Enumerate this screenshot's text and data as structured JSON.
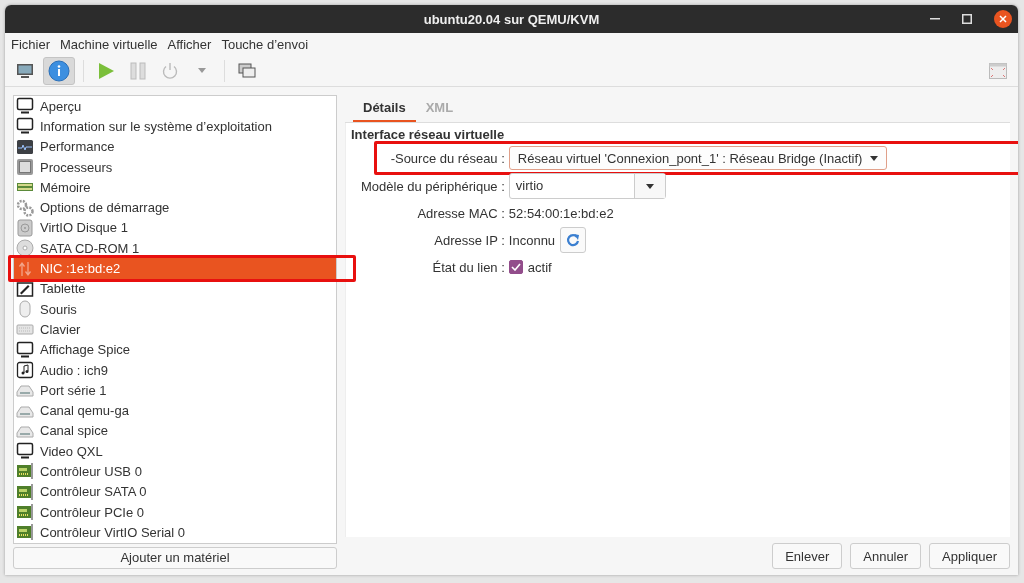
{
  "window": {
    "title": "ubuntu20.04 sur QEMU/KVM"
  },
  "menu": [
    "Fichier",
    "Machine virtuelle",
    "Afficher",
    "Touche d’envoi"
  ],
  "toolbar": [
    {
      "kind": "console",
      "selected": false
    },
    {
      "kind": "details",
      "selected": true
    },
    {
      "kind": "run",
      "selected": false
    },
    {
      "kind": "pause",
      "selected": false
    },
    {
      "kind": "power",
      "selected": false
    },
    {
      "kind": "dropdown",
      "selected": false
    },
    {
      "kind": "snapshots",
      "selected": false
    },
    {
      "kind": "fullscreen",
      "selected": false
    }
  ],
  "sidebar": {
    "items": [
      {
        "label": "Aperçu",
        "kind": "monitor",
        "selected": false,
        "annotated": false
      },
      {
        "label": "Information sur le système d’exploitation",
        "kind": "monitor",
        "selected": false,
        "annotated": false
      },
      {
        "label": "Performance",
        "kind": "performance",
        "selected": false,
        "annotated": false
      },
      {
        "label": "Processeurs",
        "kind": "cpu",
        "selected": false,
        "annotated": false
      },
      {
        "label": "Mémoire",
        "kind": "memory",
        "selected": false,
        "annotated": false
      },
      {
        "label": "Options de démarrage",
        "kind": "gears",
        "selected": false,
        "annotated": false
      },
      {
        "label": "VirtIO Disque 1",
        "kind": "disk",
        "selected": false,
        "annotated": false
      },
      {
        "label": "SATA CD-ROM 1",
        "kind": "cdrom",
        "selected": false,
        "annotated": false
      },
      {
        "label": "NIC :1e:bd:e2",
        "kind": "nic",
        "selected": true,
        "annotated": true
      },
      {
        "label": "Tablette",
        "kind": "tablet",
        "selected": false,
        "annotated": false
      },
      {
        "label": "Souris",
        "kind": "mouse",
        "selected": false,
        "annotated": false
      },
      {
        "label": "Clavier",
        "kind": "keyboard",
        "selected": false,
        "annotated": false
      },
      {
        "label": "Affichage Spice",
        "kind": "monitor",
        "selected": false,
        "annotated": false
      },
      {
        "label": "Audio : ich9",
        "kind": "audio",
        "selected": false,
        "annotated": false
      },
      {
        "label": "Port série 1",
        "kind": "serial",
        "selected": false,
        "annotated": false
      },
      {
        "label": "Canal qemu-ga",
        "kind": "serial",
        "selected": false,
        "annotated": false
      },
      {
        "label": "Canal spice",
        "kind": "serial",
        "selected": false,
        "annotated": false
      },
      {
        "label": "Video QXL",
        "kind": "monitor",
        "selected": false,
        "annotated": false
      },
      {
        "label": "Contrôleur USB 0",
        "kind": "controller",
        "selected": false,
        "annotated": false
      },
      {
        "label": "Contrôleur SATA 0",
        "kind": "controller",
        "selected": false,
        "annotated": false
      },
      {
        "label": "Contrôleur PCIe 0",
        "kind": "controller",
        "selected": false,
        "annotated": false
      },
      {
        "label": "Contrôleur VirtIO Serial 0",
        "kind": "controller",
        "selected": false,
        "annotated": false
      }
    ],
    "add_button": "Ajouter un matériel"
  },
  "tabs": [
    {
      "label": "Détails",
      "selected": true
    },
    {
      "label": "XML",
      "selected": false
    }
  ],
  "section_title": "Interface réseau virtuelle",
  "fields": [
    {
      "kind": "combo",
      "label": "-Source du réseau :",
      "value": "Réseau virtuel 'Connexion_pont_1' : Réseau Bridge (Inactif)",
      "annotated": true
    },
    {
      "kind": "entry-combo",
      "label": "Modèle du périphérique :",
      "value": "virtio",
      "annotated": false
    },
    {
      "kind": "text",
      "label": "Adresse MAC :",
      "value": "52:54:00:1e:bd:e2",
      "annotated": false
    },
    {
      "kind": "refresh",
      "label": "Adresse IP :",
      "value": "Inconnu",
      "annotated": false
    },
    {
      "kind": "checkbox",
      "label": "État du lien :",
      "value": "actif",
      "checked": true,
      "annotated": false
    }
  ],
  "buttons": [
    "Enlever",
    "Annuler",
    "Appliquer"
  ]
}
